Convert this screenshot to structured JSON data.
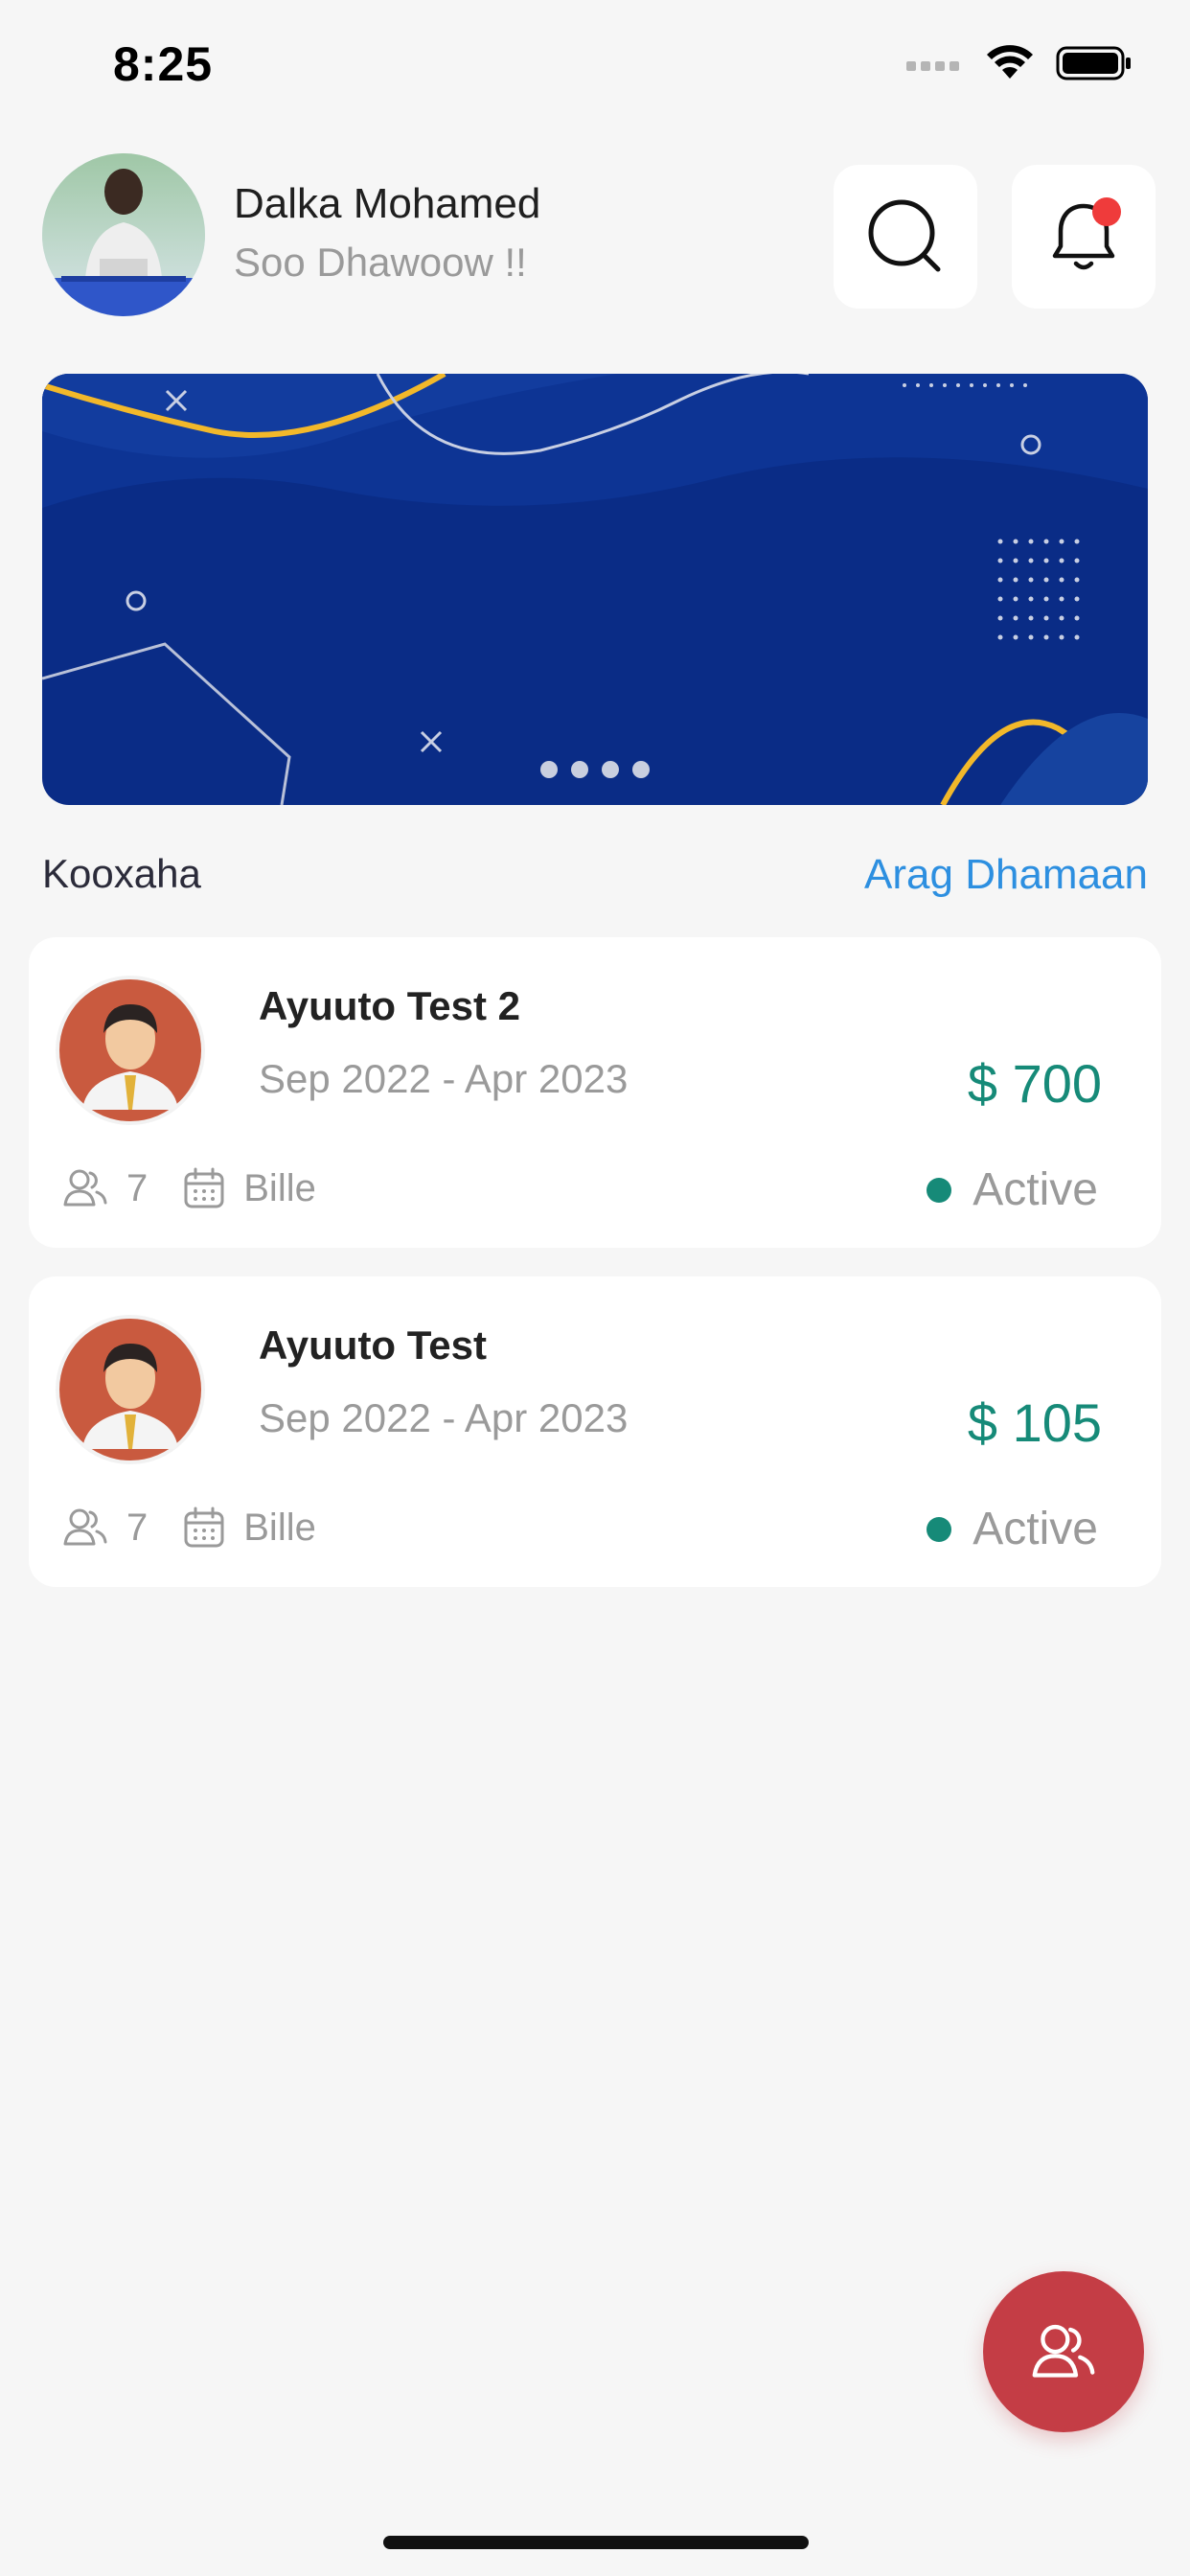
{
  "status_bar": {
    "time": "8:25"
  },
  "header": {
    "user_name": "Dalka Mohamed",
    "greeting": "Soo Dhawoow !!",
    "has_notification": true
  },
  "banner": {
    "slide_count": 4
  },
  "section": {
    "title": "Kooxaha",
    "see_all_label": "Arag Dhamaan"
  },
  "groups": [
    {
      "name": "Ayuuto Test 2",
      "dates": "Sep 2022 - Apr 2023",
      "amount": "$ 700",
      "members": "7",
      "frequency": "Bille",
      "status": "Active"
    },
    {
      "name": "Ayuuto Test",
      "dates": "Sep 2022 - Apr 2023",
      "amount": "$ 105",
      "members": "7",
      "frequency": "Bille",
      "status": "Active"
    }
  ],
  "colors": {
    "accent_blue": "#2d8fe0",
    "amount_green": "#168a78",
    "fab_red": "#c43d45",
    "banner_navy": "#0a2c86"
  },
  "icons": {
    "search": "search-icon",
    "bell": "bell-icon",
    "members": "users-icon",
    "calendar": "calendar-icon",
    "fab": "users-icon"
  }
}
